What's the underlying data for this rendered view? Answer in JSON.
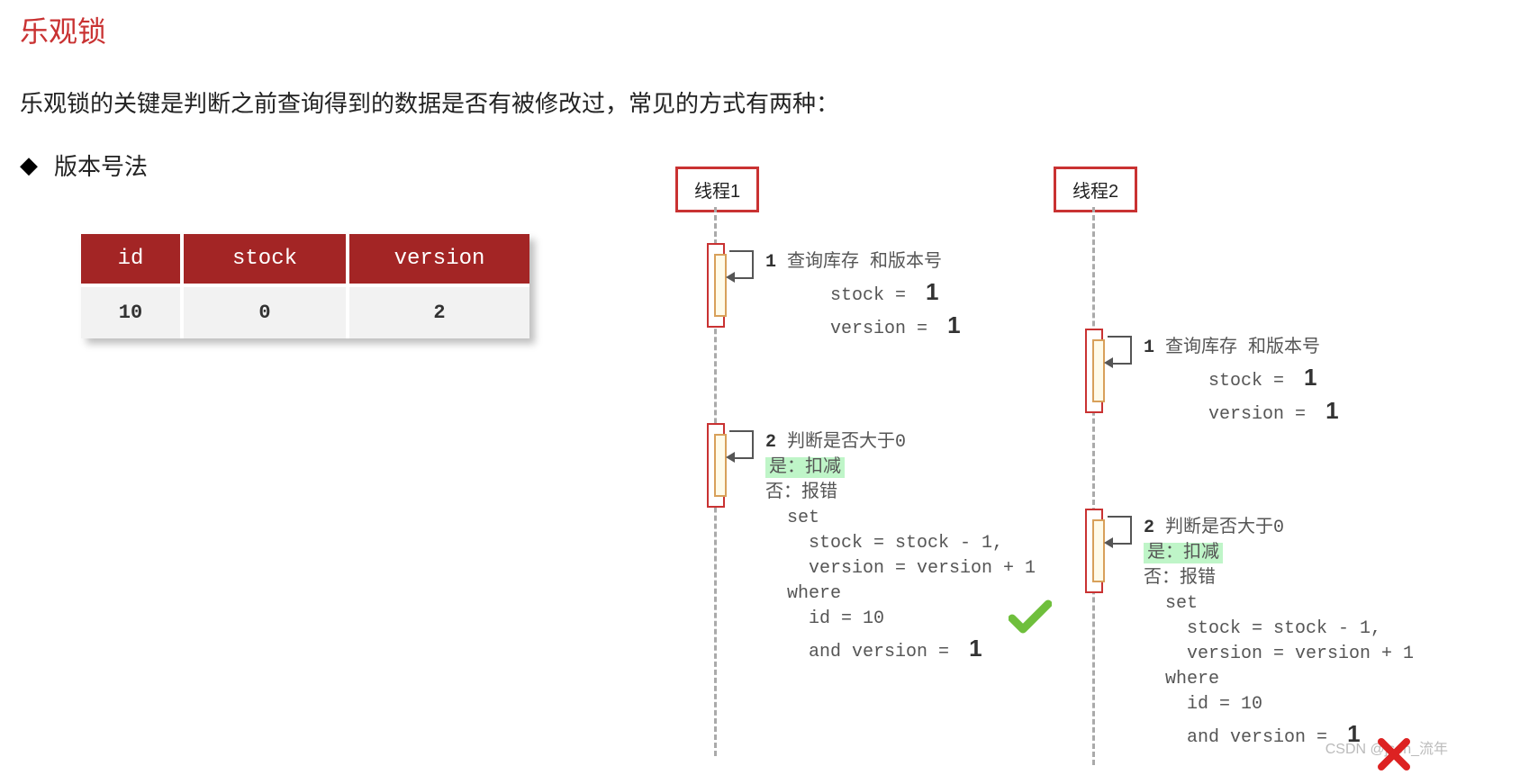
{
  "title": "乐观锁",
  "description": "乐观锁的关键是判断之前查询得到的数据是否有被修改过，常见的方式有两种：",
  "bullet_symbol": "◆",
  "bullet_text": "版本号法",
  "table": {
    "headers": [
      "id",
      "stock",
      "version"
    ],
    "row": [
      "10",
      "0",
      "2"
    ]
  },
  "thread1": {
    "label": "线程1",
    "step1": {
      "num": "1",
      "title": "查询库存  和版本号",
      "stock_lbl": "stock =",
      "stock_val": "1",
      "version_lbl": "version =",
      "version_val": "1"
    },
    "step2": {
      "num": "2",
      "title": "判断是否大于0",
      "yes": "是：扣减",
      "no": "否：报错",
      "sql_set": "set",
      "sql_l1": "stock = stock - 1,",
      "sql_l2": "version = version + 1",
      "sql_where": "where",
      "sql_l3": "id = 10",
      "sql_l4": "and version =",
      "sql_ver_val": "1"
    },
    "result": "success"
  },
  "thread2": {
    "label": "线程2",
    "step1": {
      "num": "1",
      "title": "查询库存  和版本号",
      "stock_lbl": "stock =",
      "stock_val": "1",
      "version_lbl": "version =",
      "version_val": "1"
    },
    "step2": {
      "num": "2",
      "title": "判断是否大于0",
      "yes": "是：扣减",
      "no": "否：报错",
      "sql_set": "set",
      "sql_l1": "stock = stock - 1,",
      "sql_l2": "version = version + 1",
      "sql_where": "where",
      "sql_l3": "id = 10",
      "sql_l4": "and version =",
      "sql_ver_val": "1"
    },
    "result": "fail"
  },
  "watermark": "CSDN @json_流年"
}
